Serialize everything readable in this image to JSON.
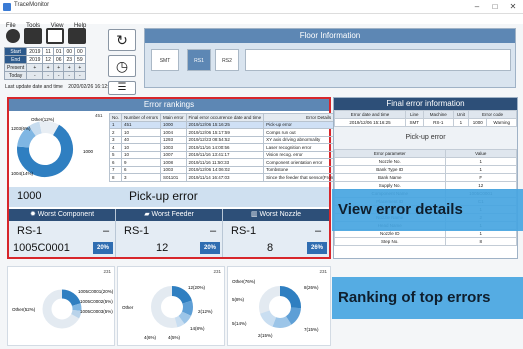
{
  "window": {
    "title": "TraceMonitor",
    "minimize": "–",
    "maximize": "□",
    "close": "✕"
  },
  "menu": [
    "File",
    "Tools",
    "View",
    "Help"
  ],
  "time_panel": {
    "rows": [
      {
        "label": "Start",
        "values": [
          "2019",
          "11",
          "01",
          "00",
          "00"
        ]
      },
      {
        "label": "End",
        "values": [
          "2019",
          "12",
          "06",
          "23",
          "59"
        ]
      },
      {
        "label": "Present",
        "values": [
          "+",
          "+",
          "+",
          "+",
          "+"
        ]
      },
      {
        "label": "Today",
        "values": [
          "-",
          "-",
          "-",
          "-",
          "-"
        ]
      }
    ],
    "last_update_label": "Last update date and time",
    "last_update_value": "2020/02/26 16:12:28"
  },
  "floor": {
    "title": "Floor Information",
    "buttons": [
      "SMT",
      "RS1",
      "RS2"
    ],
    "selected": "RS1"
  },
  "rankings": {
    "title": "Error rankings",
    "count": "451",
    "columns": [
      "No.",
      "Number of errors",
      "Main error",
      "Final error occurrence date and time",
      "Error Details"
    ],
    "rows": [
      [
        "1",
        "451",
        "1000",
        "2019/12/06 15:16:25",
        "Pick-up error"
      ],
      [
        "2",
        "10",
        "1004",
        "2019/12/06 15:17:59",
        "Comps run out"
      ],
      [
        "3",
        "40",
        "1293",
        "2019/12/23 08:54:52",
        "XY axis driving abnormality"
      ],
      [
        "4",
        "10",
        "1003",
        "2019/11/16 14:00:56",
        "Laser recognition error"
      ],
      [
        "5",
        "10",
        "1007",
        "2019/11/16 13:41:17",
        "Vision recog. error"
      ],
      [
        "6",
        "9",
        "1008",
        "2019/11/16 11:50:33",
        "Component orientation error"
      ],
      [
        "7",
        "6",
        "1003",
        "2019/12/06 14:06:02",
        "Tombstone"
      ],
      [
        "8",
        "3",
        "S01101",
        "2019/11/14 16:47:03",
        "Since the feeder that sensor(Front) has reacted, it cannot operat..."
      ]
    ],
    "pie_labels": [
      "Other(12%)",
      "1203(6%)",
      "1004(14%)",
      "1000"
    ],
    "pickup_code": "1000",
    "pickup_text": "Pick-up error"
  },
  "worst": [
    {
      "title": "Worst Component",
      "machine": "RS-1",
      "dash": "–",
      "code": "1005C0001",
      "pct": "20%"
    },
    {
      "title": "Worst Feeder",
      "machine": "RS-1",
      "dash": "–",
      "code": "12",
      "pct": "20%"
    },
    {
      "title": "Worst Nozzle",
      "machine": "RS-1",
      "dash": "–",
      "code": "8",
      "pct": "26%"
    }
  ],
  "final_error": {
    "title": "Final error information",
    "columns": [
      "Error date and time",
      "Line",
      "Machine",
      "Unit",
      "Error code"
    ],
    "row": [
      "2019/12/06 15:16:25",
      "SMT",
      "RS-1",
      "1",
      "1000",
      "Warning"
    ],
    "subtitle": "Pick-up error",
    "param_columns": [
      "Error parameter",
      "Value"
    ],
    "params": [
      [
        "Nozzle No.",
        "1"
      ],
      [
        "Bank Type ID",
        "1"
      ],
      [
        "Bank Name",
        "F"
      ],
      [
        "Supply No.",
        "12"
      ],
      [
        "Component Name",
        "1005C0001"
      ],
      [
        "Placement ID",
        "C1"
      ],
      [
        "ATC Position",
        "1"
      ],
      [
        "Nozzle Name",
        "2"
      ],
      [
        "Head Name",
        "1"
      ],
      [
        "Nozzle ID",
        "1"
      ],
      [
        "Step No.",
        "8"
      ]
    ]
  },
  "callouts": {
    "view_details": "View error details",
    "ranking": "Ranking of top errors"
  },
  "bottom_charts": [
    {
      "count": "231",
      "labels": [
        "Other(52%)",
        "1005C0001(20%)",
        "1005C0002(5%)",
        "1005C0003(5%)"
      ]
    },
    {
      "count": "231",
      "labels": [
        "Other",
        "12(20%)",
        "2(12%)",
        "14(8%)",
        "4(6%)",
        "4(5%)"
      ]
    },
    {
      "count": "231",
      "labels": [
        "Other(76%)",
        "8(26%)",
        "5(8%)",
        "5(14%)",
        "2(15%)",
        "7(15%)"
      ]
    }
  ],
  "colors": {
    "highlight": "#d7262b",
    "header": "#2d4f78",
    "accent": "#2f6db1",
    "callout": "#46a5e1"
  }
}
